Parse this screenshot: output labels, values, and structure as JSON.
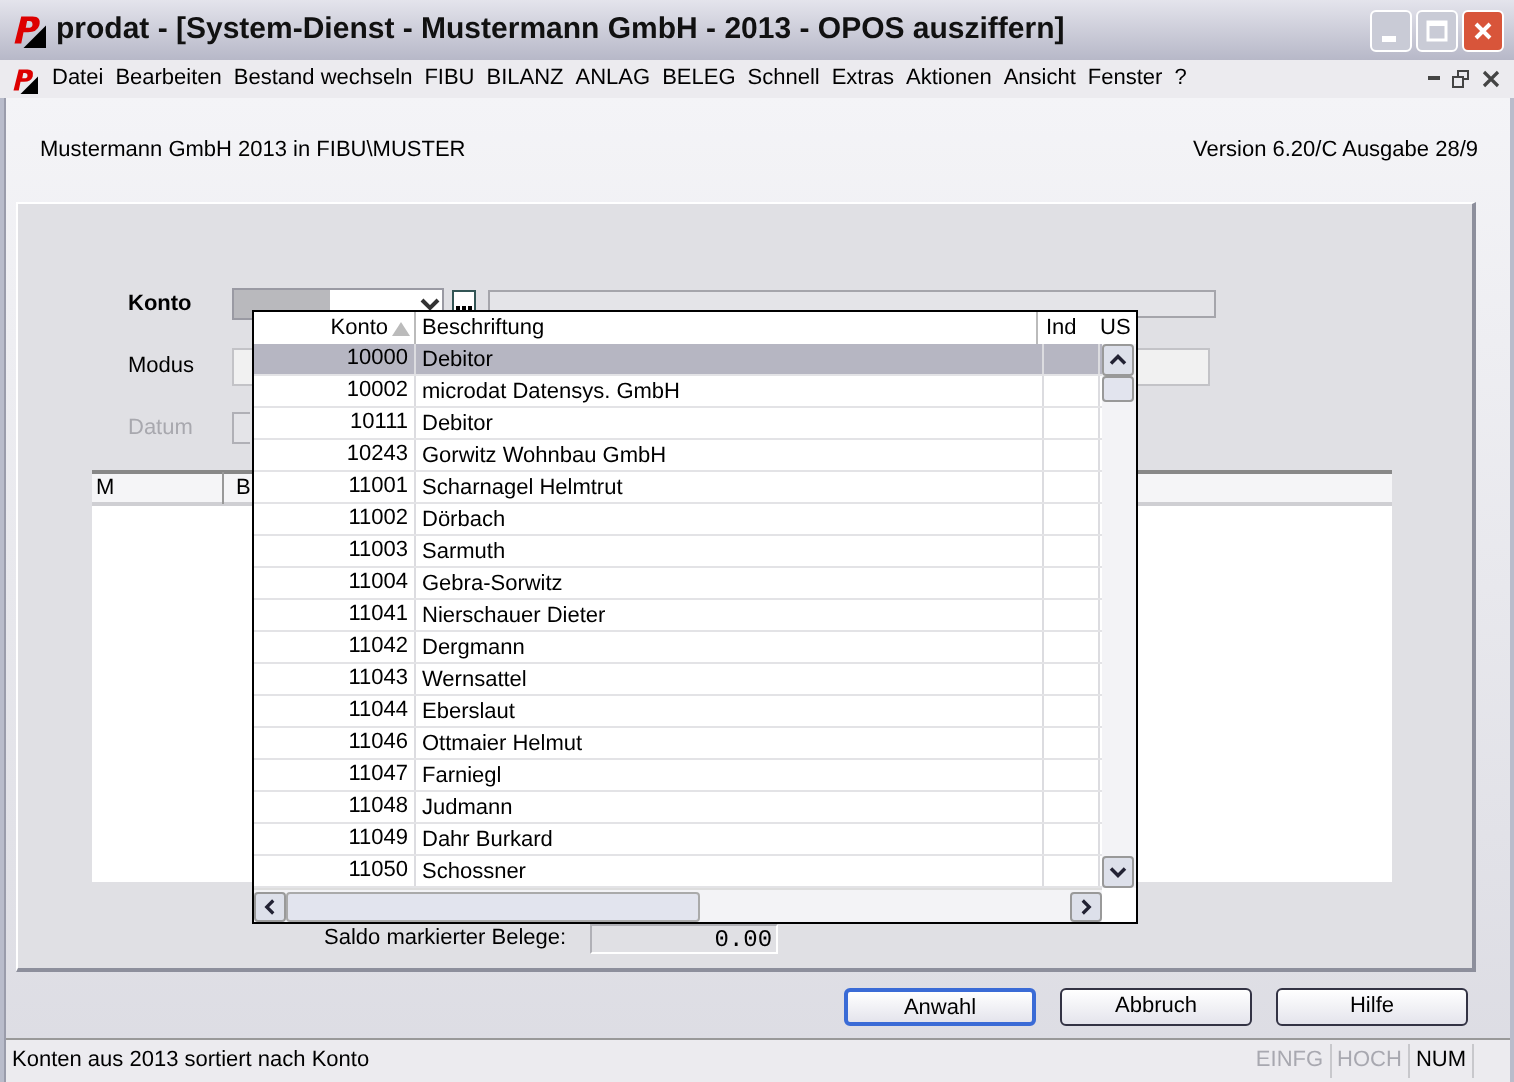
{
  "window": {
    "title": "prodat - [System-Dienst - Mustermann GmbH - 2013 - OPOS ausziffern]"
  },
  "menu": [
    "Datei",
    "Bearbeiten",
    "Bestand wechseln",
    "FIBU",
    "BILANZ",
    "ANLAG",
    "BELEG",
    "Schnell",
    "Extras",
    "Aktionen",
    "Ansicht",
    "Fenster",
    "?"
  ],
  "header": {
    "company": "Mustermann GmbH 2013 in FIBU\\MUSTER",
    "version": "Version 6.20/C Ausgabe 28/9"
  },
  "form": {
    "fields": [
      {
        "label": "Konto",
        "disabled": false
      },
      {
        "label": "Modus",
        "disabled": false
      },
      {
        "label": "Datum",
        "disabled": true
      }
    ]
  },
  "grid": {
    "columns": [
      "M",
      "B"
    ]
  },
  "popup": {
    "columns": [
      "Konto",
      "Beschriftung",
      "Ind",
      "US"
    ],
    "rows": [
      {
        "konto": "10000",
        "name": "Debitor",
        "selected": true
      },
      {
        "konto": "10002",
        "name": "microdat Datensys. GmbH",
        "selected": false
      },
      {
        "konto": "10111",
        "name": "Debitor",
        "selected": false
      },
      {
        "konto": "10243",
        "name": "Gorwitz Wohnbau GmbH",
        "selected": false
      },
      {
        "konto": "11001",
        "name": "Scharnagel Helmtrut",
        "selected": false
      },
      {
        "konto": "11002",
        "name": "Dörbach",
        "selected": false
      },
      {
        "konto": "11003",
        "name": "Sarmuth",
        "selected": false
      },
      {
        "konto": "11004",
        "name": "Gebra-Sorwitz",
        "selected": false
      },
      {
        "konto": "11041",
        "name": "Nierschauer Dieter",
        "selected": false
      },
      {
        "konto": "11042",
        "name": "Dergmann",
        "selected": false
      },
      {
        "konto": "11043",
        "name": "Wernsattel",
        "selected": false
      },
      {
        "konto": "11044",
        "name": "Eberslaut",
        "selected": false
      },
      {
        "konto": "11046",
        "name": "Ottmaier Helmut",
        "selected": false
      },
      {
        "konto": "11047",
        "name": "Farniegl",
        "selected": false
      },
      {
        "konto": "11048",
        "name": "Judmann",
        "selected": false
      },
      {
        "konto": "11049",
        "name": "Dahr Burkard",
        "selected": false
      },
      {
        "konto": "11050",
        "name": "Schossner",
        "selected": false
      }
    ]
  },
  "saldo": {
    "label": "Saldo markierter Belege:",
    "value": "0.00"
  },
  "buttons": [
    "Anwahl",
    "Abbruch",
    "Hilfe"
  ],
  "status_bar": {
    "text": "Konten aus 2013 sortiert nach Konto",
    "indicators": [
      {
        "label": "EINFG",
        "on": false
      },
      {
        "label": "HOCH",
        "on": false
      },
      {
        "label": "NUM",
        "on": true
      }
    ]
  }
}
